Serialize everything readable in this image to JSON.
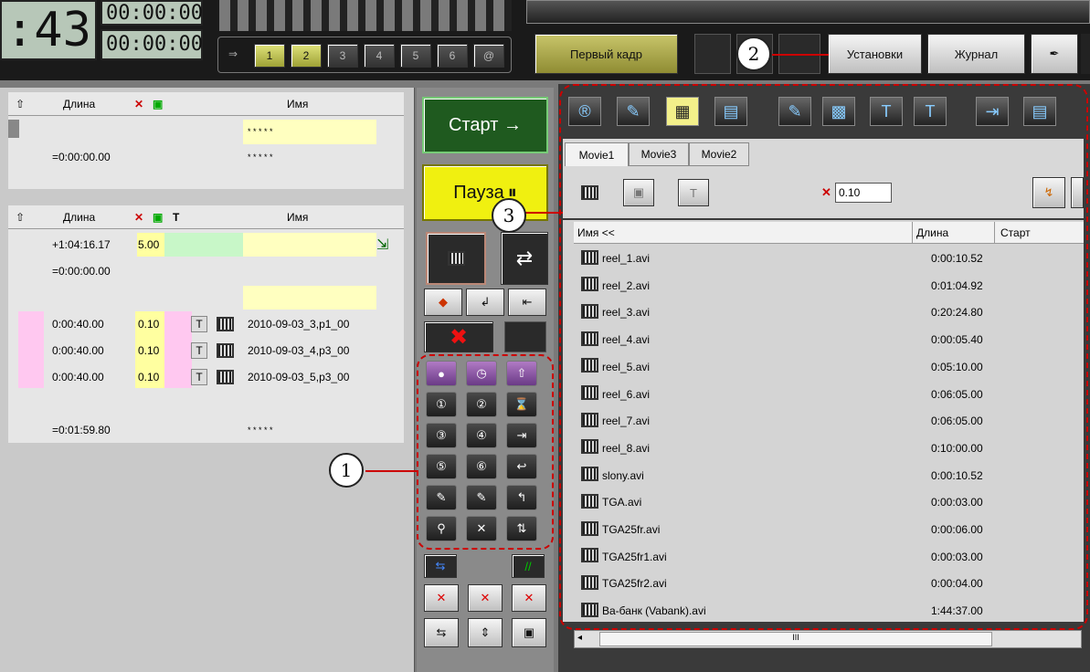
{
  "top": {
    "time_big": ":43",
    "time_a": "00:00:00",
    "time_b": "00:00:00",
    "arrow": "⇒",
    "channels": [
      "1",
      "2",
      "3",
      "4",
      "5",
      "6",
      "@"
    ],
    "first_frame": "Первый кадр",
    "settings": "Установки",
    "journal": "Журнал"
  },
  "upper_list": {
    "col_length": "Длина",
    "col_name": "Имя",
    "rows": [
      {
        "len": "",
        "name": "* * * * *"
      },
      {
        "len": "=0:00:00.00",
        "name": "* * * * *"
      }
    ]
  },
  "lower_list": {
    "col_length": "Длина",
    "col_name": "Имя",
    "rows": [
      {
        "len": "+1:04:16.17",
        "speed": "5.00",
        "name": ""
      },
      {
        "len": "=0:00:00.00",
        "speed": "",
        "name": ""
      },
      {
        "len": "",
        "speed": "",
        "name": ""
      },
      {
        "len": "0:00:40.00",
        "speed": "0.10",
        "name": "2010-09-03_3,p1_00"
      },
      {
        "len": "0:00:40.00",
        "speed": "0.10",
        "name": "2010-09-03_4,p3_00"
      },
      {
        "len": "0:00:40.00",
        "speed": "0.10",
        "name": "2010-09-03_5,p3_00"
      },
      {
        "len": "",
        "speed": "",
        "name": ""
      },
      {
        "len": "=0:01:59.80",
        "speed": "",
        "name": "* * * * *"
      }
    ]
  },
  "controls": {
    "start": "Старт →",
    "pause": "Пауза"
  },
  "browser": {
    "tabs": [
      "Movie1",
      "Movie3",
      "Movie2"
    ],
    "speed_value": "0.10",
    "col_name": "Имя <<",
    "col_length": "Длина",
    "col_start": "Старт",
    "files": [
      {
        "name": "reel_1.avi",
        "len": "0:00:10.52"
      },
      {
        "name": "reel_2.avi",
        "len": "0:01:04.92"
      },
      {
        "name": "reel_3.avi",
        "len": "0:20:24.80"
      },
      {
        "name": "reel_4.avi",
        "len": "0:00:05.40"
      },
      {
        "name": "reel_5.avi",
        "len": "0:05:10.00"
      },
      {
        "name": "reel_6.avi",
        "len": "0:06:05.00"
      },
      {
        "name": "reel_7.avi",
        "len": "0:06:05.00"
      },
      {
        "name": "reel_8.avi",
        "len": "0:10:00.00"
      },
      {
        "name": "slony.avi",
        "len": "0:00:10.52"
      },
      {
        "name": "TGA.avi",
        "len": "0:00:03.00"
      },
      {
        "name": "TGA25fr.avi",
        "len": "0:00:06.00"
      },
      {
        "name": "TGA25fr1.avi",
        "len": "0:00:03.00"
      },
      {
        "name": "TGA25fr2.avi",
        "len": "0:00:04.00"
      },
      {
        "name": "Ва-банк (Vabank).avi",
        "len": "1:44:37.00"
      }
    ],
    "scroll_mark": "III"
  },
  "callouts": [
    "1",
    "2",
    "3"
  ]
}
